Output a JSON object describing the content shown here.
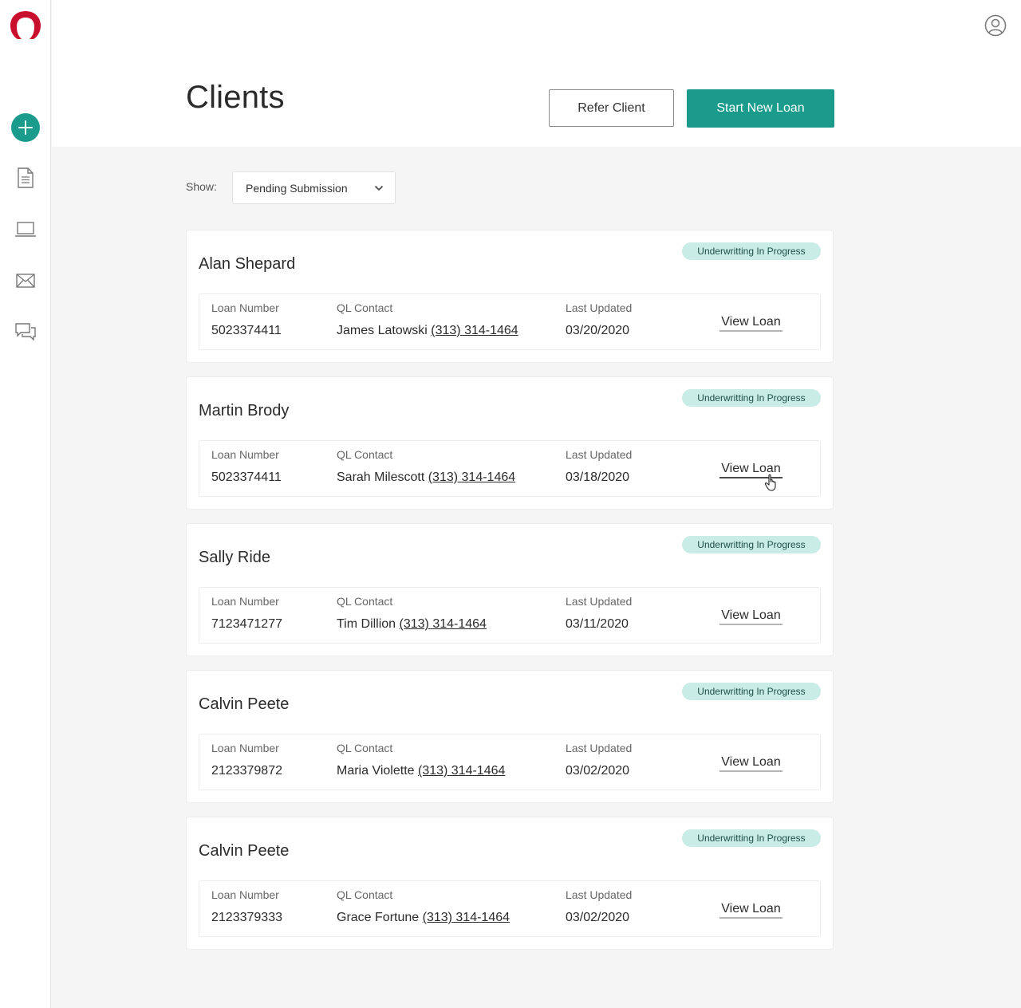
{
  "header": {
    "page_title": "Clients",
    "refer_button": "Refer Client",
    "start_button": "Start New Loan"
  },
  "sidebar": {
    "icons": [
      "logo-icon",
      "plus-icon",
      "document-icon",
      "laptop-icon",
      "mail-icon",
      "chat-icon"
    ]
  },
  "filter": {
    "label": "Show:",
    "selected": "Pending Submission"
  },
  "columns": {
    "loan_number": "Loan Number",
    "ql_contact": "QL Contact",
    "last_updated": "Last Updated",
    "action": "View Loan"
  },
  "clients": [
    {
      "name": "Alan Shepard",
      "status": "Underwritting In Progress",
      "loan_number": "5023374411",
      "contact_name": "James Latowski",
      "contact_phone": "(313) 314-1464",
      "last_updated": "03/20/2020"
    },
    {
      "name": "Martin Brody",
      "status": "Underwritting In Progress",
      "loan_number": "5023374411",
      "contact_name": "Sarah Milescott",
      "contact_phone": "(313) 314-1464",
      "last_updated": "03/18/2020"
    },
    {
      "name": "Sally Ride",
      "status": "Underwritting In Progress",
      "loan_number": "7123471277",
      "contact_name": "Tim Dillion",
      "contact_phone": "(313) 314-1464",
      "last_updated": "03/11/2020"
    },
    {
      "name": "Calvin Peete",
      "status": "Underwritting In Progress",
      "loan_number": "2123379872",
      "contact_name": "Maria Violette",
      "contact_phone": "(313) 314-1464",
      "last_updated": "03/02/2020"
    },
    {
      "name": "Calvin Peete",
      "status": "Underwritting In Progress",
      "loan_number": "2123379333",
      "contact_name": "Grace Fortune",
      "contact_phone": "(313) 314-1464",
      "last_updated": "03/02/2020"
    }
  ],
  "colors": {
    "accent": "#1a9b8b",
    "brand": "#c8102e",
    "badge_bg": "#c9ece6"
  }
}
